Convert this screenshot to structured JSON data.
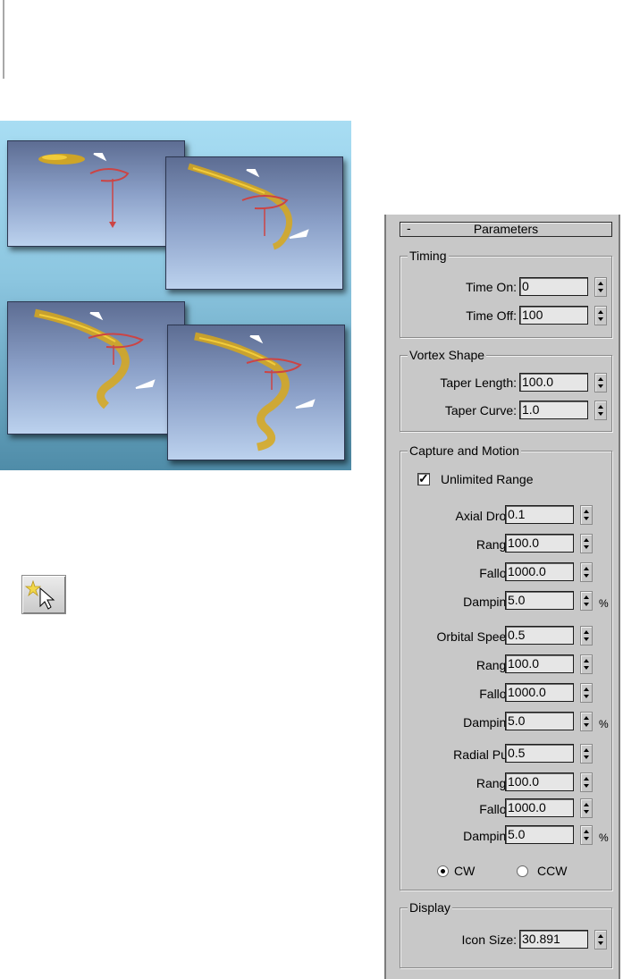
{
  "tool_icon": "particle-tool-icon",
  "panel": {
    "rollout_title": "Parameters",
    "collapse_symbol": "-",
    "timing": {
      "title": "Timing",
      "time_on_label": "Time On:",
      "time_on_value": "0",
      "time_off_label": "Time Off:",
      "time_off_value": "100"
    },
    "vortex_shape": {
      "title": "Vortex Shape",
      "taper_length_label": "Taper Length:",
      "taper_length_value": "100.0",
      "taper_curve_label": "Taper Curve:",
      "taper_curve_value": "1.0"
    },
    "capture": {
      "title": "Capture and Motion",
      "unlimited_range_label": "Unlimited Range",
      "unlimited_range_checked": true,
      "axial_drop_label": "Axial Drop:",
      "axial_drop_value": "0.1",
      "axial_range_label": "Range:",
      "axial_range_value": "100.0",
      "axial_falloff_label": "Falloff:",
      "axial_falloff_value": "1000.0",
      "axial_damping_label": "Damping:",
      "axial_damping_value": "5.0",
      "orbital_speed_label": "Orbital Speed:",
      "orbital_speed_value": "0.5",
      "orbital_range_label": "Range:",
      "orbital_range_value": "100.0",
      "orbital_falloff_label": "Falloff:",
      "orbital_falloff_value": "1000.0",
      "orbital_damping_label": "Damping:",
      "orbital_damping_value": "5.0",
      "radial_pull_label": "Radial Pull:",
      "radial_pull_value": "0.5",
      "radial_range_label": "Range:",
      "radial_range_value": "100.0",
      "radial_falloff_label": "Falloff:",
      "radial_falloff_value": "1000.0",
      "radial_damping_label": "Damping:",
      "radial_damping_value": "5.0",
      "percent": "%",
      "cw_label": "CW",
      "ccw_label": "CCW",
      "direction_selected": "CW"
    },
    "display": {
      "title": "Display",
      "icon_size_label": "Icon Size:",
      "icon_size_value": "30.891"
    }
  }
}
